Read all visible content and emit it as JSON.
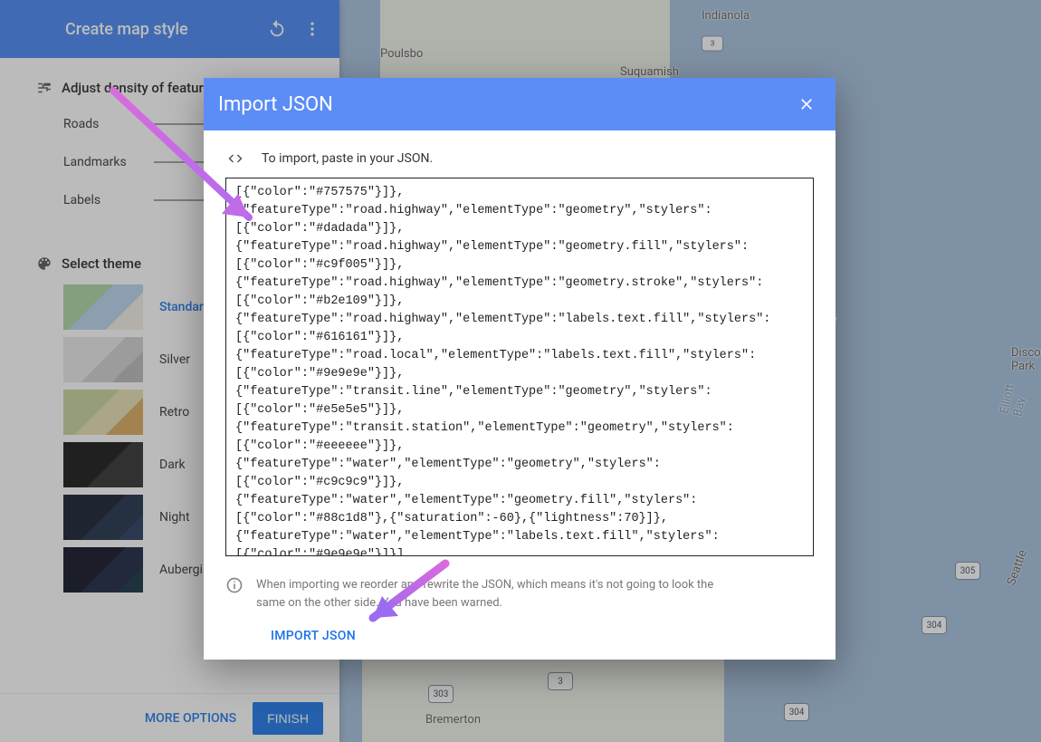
{
  "header": {
    "title": "Create map style"
  },
  "density": {
    "heading": "Adjust density of features",
    "rows": [
      "Roads",
      "Landmarks",
      "Labels"
    ]
  },
  "themeSection": {
    "heading": "Select theme",
    "themes": [
      {
        "label": "Standard",
        "cls": "sw-standard",
        "selected": true
      },
      {
        "label": "Silver",
        "cls": "sw-silver"
      },
      {
        "label": "Retro",
        "cls": "sw-retro"
      },
      {
        "label": "Dark",
        "cls": "sw-dark"
      },
      {
        "label": "Night",
        "cls": "sw-night"
      },
      {
        "label": "Aubergine",
        "cls": "sw-aubergine"
      }
    ]
  },
  "footer": {
    "more": "MORE OPTIONS",
    "finish": "FINISH"
  },
  "dialog": {
    "title": "Import JSON",
    "prompt": "To import, paste in your JSON.",
    "json": "[{\"color\":\"#757575\"}]},\n{\"featureType\":\"road.highway\",\"elementType\":\"geometry\",\"stylers\":[{\"color\":\"#dadada\"}]},\n{\"featureType\":\"road.highway\",\"elementType\":\"geometry.fill\",\"stylers\":[{\"color\":\"#c9f005\"}]},\n{\"featureType\":\"road.highway\",\"elementType\":\"geometry.stroke\",\"stylers\":[{\"color\":\"#b2e109\"}]},\n{\"featureType\":\"road.highway\",\"elementType\":\"labels.text.fill\",\"stylers\":[{\"color\":\"#616161\"}]},\n{\"featureType\":\"road.local\",\"elementType\":\"labels.text.fill\",\"stylers\":[{\"color\":\"#9e9e9e\"}]},\n{\"featureType\":\"transit.line\",\"elementType\":\"geometry\",\"stylers\":[{\"color\":\"#e5e5e5\"}]},\n{\"featureType\":\"transit.station\",\"elementType\":\"geometry\",\"stylers\":[{\"color\":\"#eeeeee\"}]},\n{\"featureType\":\"water\",\"elementType\":\"geometry\",\"stylers\":[{\"color\":\"#c9c9c9\"}]},\n{\"featureType\":\"water\",\"elementType\":\"geometry.fill\",\"stylers\":[{\"color\":\"#88c1d8\"},{\"saturation\":-60},{\"lightness\":70}]},\n{\"featureType\":\"water\",\"elementType\":\"labels.text.fill\",\"stylers\":[{\"color\":\"#9e9e9e\"}]}]",
    "warning": "When importing we reorder and rewrite the JSON, which means it's not going to look the same on the other side. You have been warned.",
    "action": "IMPORT JSON"
  },
  "map": {
    "cities": [
      "Indianola",
      "Poulsbo",
      "Suquamish",
      "Bremerton"
    ],
    "labels": [
      "Discovery Park",
      "Elliott Bay",
      "Seattle"
    ],
    "shields": [
      "303",
      "3",
      "305",
      "304",
      "3",
      "304"
    ]
  }
}
